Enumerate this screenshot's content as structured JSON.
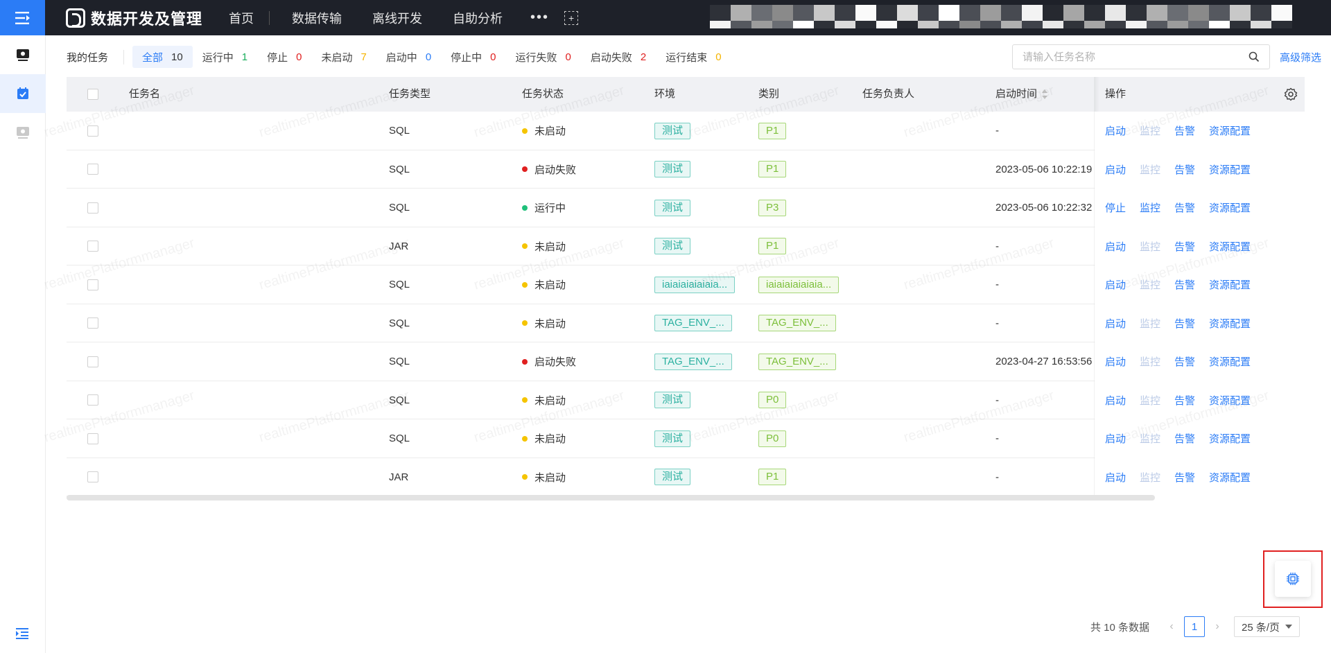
{
  "topbar": {
    "app_title": "数据开发及管理",
    "nav": [
      "首页",
      "数据传输",
      "离线开发",
      "自助分析"
    ],
    "more_label": "•••",
    "add_label": "+",
    "colors": {
      "bar_bg": "#1e2129",
      "toggle_bg": "#2b7cf6"
    }
  },
  "sidebar": {
    "items": [
      "monitor-icon",
      "task-calendar-icon",
      "monitor-icon"
    ],
    "collapse_icon": "expand-menu-icon"
  },
  "filters": {
    "my_tasks": "我的任务",
    "items": [
      {
        "label": "全部",
        "count": "10",
        "color": "#333333",
        "active": true
      },
      {
        "label": "运行中",
        "count": "1",
        "color": "#1aad5c"
      },
      {
        "label": "停止",
        "count": "0",
        "color": "#e02020"
      },
      {
        "label": "未启动",
        "count": "7",
        "color": "#f5b400"
      },
      {
        "label": "启动中",
        "count": "0",
        "color": "#2b7cf6"
      },
      {
        "label": "停止中",
        "count": "0",
        "color": "#e02020"
      },
      {
        "label": "运行失败",
        "count": "0",
        "color": "#e02020"
      },
      {
        "label": "启动失败",
        "count": "2",
        "color": "#e02020"
      },
      {
        "label": "运行结束",
        "count": "0",
        "color": "#f5b400"
      }
    ],
    "search_placeholder": "请输入任务名称",
    "advanced": "高级筛选"
  },
  "table": {
    "columns": [
      "任务名",
      "任务类型",
      "任务状态",
      "环境",
      "类别",
      "任务负责人",
      "启动时间",
      "操作"
    ],
    "rows": [
      {
        "type": "SQL",
        "status": "未启动",
        "status_color": "#f5c400",
        "env": "测试",
        "category": "P1",
        "start_time": "-",
        "actions": [
          {
            "label": "启动",
            "enabled": true
          },
          {
            "label": "监控",
            "enabled": false
          },
          {
            "label": "告警",
            "enabled": true
          },
          {
            "label": "资源配置",
            "enabled": true
          }
        ]
      },
      {
        "type": "SQL",
        "status": "启动失败",
        "status_color": "#e02020",
        "env": "测试",
        "category": "P1",
        "start_time": "2023-05-06 10:22:19",
        "actions": [
          {
            "label": "启动",
            "enabled": true
          },
          {
            "label": "监控",
            "enabled": false
          },
          {
            "label": "告警",
            "enabled": true
          },
          {
            "label": "资源配置",
            "enabled": true
          }
        ]
      },
      {
        "type": "SQL",
        "status": "运行中",
        "status_color": "#1fc07a",
        "env": "测试",
        "category": "P3",
        "start_time": "2023-05-06 10:22:32",
        "actions": [
          {
            "label": "停止",
            "enabled": true
          },
          {
            "label": "监控",
            "enabled": true
          },
          {
            "label": "告警",
            "enabled": true
          },
          {
            "label": "资源配置",
            "enabled": true
          }
        ]
      },
      {
        "type": "JAR",
        "status": "未启动",
        "status_color": "#f5c400",
        "env": "测试",
        "category": "P1",
        "start_time": "-",
        "actions": [
          {
            "label": "启动",
            "enabled": true
          },
          {
            "label": "监控",
            "enabled": false
          },
          {
            "label": "告警",
            "enabled": true
          },
          {
            "label": "资源配置",
            "enabled": true
          }
        ]
      },
      {
        "type": "SQL",
        "status": "未启动",
        "status_color": "#f5c400",
        "env": "iaiaiaiaiaiaia...",
        "category": "iaiaiaiaiaiaia...",
        "start_time": "-",
        "actions": [
          {
            "label": "启动",
            "enabled": true
          },
          {
            "label": "监控",
            "enabled": false
          },
          {
            "label": "告警",
            "enabled": true
          },
          {
            "label": "资源配置",
            "enabled": true
          }
        ]
      },
      {
        "type": "SQL",
        "status": "未启动",
        "status_color": "#f5c400",
        "env": "TAG_ENV_...",
        "category": "TAG_ENV_...",
        "start_time": "-",
        "actions": [
          {
            "label": "启动",
            "enabled": true
          },
          {
            "label": "监控",
            "enabled": false
          },
          {
            "label": "告警",
            "enabled": true
          },
          {
            "label": "资源配置",
            "enabled": true
          }
        ]
      },
      {
        "type": "SQL",
        "status": "启动失败",
        "status_color": "#e02020",
        "env": "TAG_ENV_...",
        "category": "TAG_ENV_...",
        "start_time": "2023-04-27 16:53:56",
        "actions": [
          {
            "label": "启动",
            "enabled": true
          },
          {
            "label": "监控",
            "enabled": false
          },
          {
            "label": "告警",
            "enabled": true
          },
          {
            "label": "资源配置",
            "enabled": true
          }
        ]
      },
      {
        "type": "SQL",
        "status": "未启动",
        "status_color": "#f5c400",
        "env": "测试",
        "category": "P0",
        "start_time": "-",
        "actions": [
          {
            "label": "启动",
            "enabled": true
          },
          {
            "label": "监控",
            "enabled": false
          },
          {
            "label": "告警",
            "enabled": true
          },
          {
            "label": "资源配置",
            "enabled": true
          }
        ]
      },
      {
        "type": "SQL",
        "status": "未启动",
        "status_color": "#f5c400",
        "env": "测试",
        "category": "P0",
        "start_time": "-",
        "actions": [
          {
            "label": "启动",
            "enabled": true
          },
          {
            "label": "监控",
            "enabled": false
          },
          {
            "label": "告警",
            "enabled": true
          },
          {
            "label": "资源配置",
            "enabled": true
          }
        ]
      },
      {
        "type": "JAR",
        "status": "未启动",
        "status_color": "#f5c400",
        "env": "测试",
        "category": "P1",
        "start_time": "-",
        "actions": [
          {
            "label": "启动",
            "enabled": true
          },
          {
            "label": "监控",
            "enabled": false
          },
          {
            "label": "告警",
            "enabled": true
          },
          {
            "label": "资源配置",
            "enabled": true
          }
        ]
      }
    ]
  },
  "pagination": {
    "total": "共 10 条数据",
    "current_page": "1",
    "page_size": "25 条/页"
  },
  "watermark": "realtimePlatformmanager"
}
